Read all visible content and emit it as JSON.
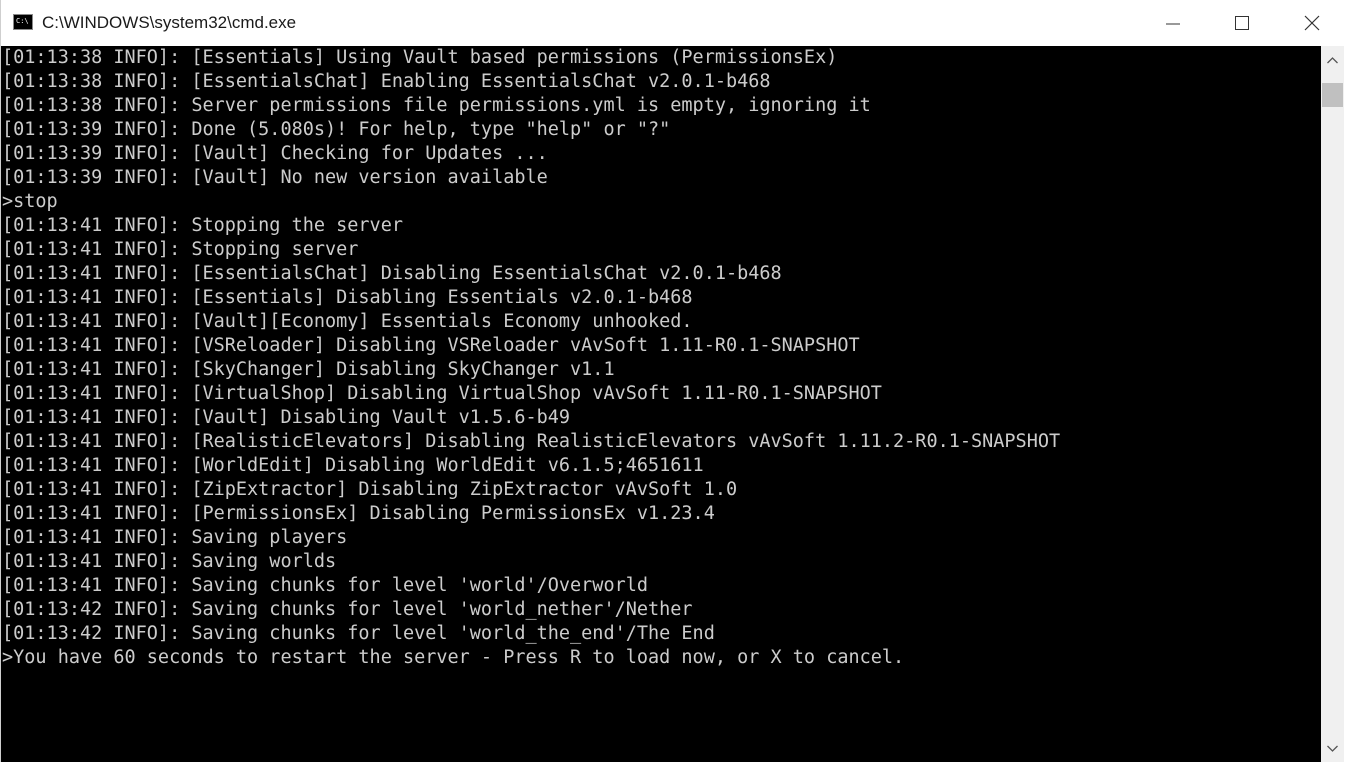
{
  "window": {
    "title": "C:\\WINDOWS\\system32\\cmd.exe",
    "app_icon_text": "C:\\",
    "controls": {
      "minimize": "minimize",
      "maximize": "maximize",
      "close": "close"
    }
  },
  "colors": {
    "console_background": "#000000",
    "console_text": "#cccccc",
    "titlebar": "#ffffff",
    "scrollbar_track": "#f0f0f0",
    "scrollbar_thumb": "#c0c0c0"
  },
  "console": {
    "lines": [
      "[01:13:38 INFO]: [Essentials] Using Vault based permissions (PermissionsEx)",
      "[01:13:38 INFO]: [EssentialsChat] Enabling EssentialsChat v2.0.1-b468",
      "[01:13:38 INFO]: Server permissions file permissions.yml is empty, ignoring it",
      "[01:13:39 INFO]: Done (5.080s)! For help, type \"help\" or \"?\"",
      "[01:13:39 INFO]: [Vault] Checking for Updates ...",
      "[01:13:39 INFO]: [Vault] No new version available",
      ">stop",
      "[01:13:41 INFO]: Stopping the server",
      "[01:13:41 INFO]: Stopping server",
      "[01:13:41 INFO]: [EssentialsChat] Disabling EssentialsChat v2.0.1-b468",
      "[01:13:41 INFO]: [Essentials] Disabling Essentials v2.0.1-b468",
      "[01:13:41 INFO]: [Vault][Economy] Essentials Economy unhooked.",
      "[01:13:41 INFO]: [VSReloader] Disabling VSReloader vAvSoft 1.11-R0.1-SNAPSHOT",
      "[01:13:41 INFO]: [SkyChanger] Disabling SkyChanger v1.1",
      "[01:13:41 INFO]: [VirtualShop] Disabling VirtualShop vAvSoft 1.11-R0.1-SNAPSHOT",
      "[01:13:41 INFO]: [Vault] Disabling Vault v1.5.6-b49",
      "[01:13:41 INFO]: [RealisticElevators] Disabling RealisticElevators vAvSoft 1.11.2-R0.1-SNAPSHOT",
      "[01:13:41 INFO]: [WorldEdit] Disabling WorldEdit v6.1.5;4651611",
      "[01:13:41 INFO]: [ZipExtractor] Disabling ZipExtractor vAvSoft 1.0",
      "[01:13:41 INFO]: [PermissionsEx] Disabling PermissionsEx v1.23.4",
      "[01:13:41 INFO]: Saving players",
      "[01:13:41 INFO]: Saving worlds",
      "[01:13:41 INFO]: Saving chunks for level 'world'/Overworld",
      "[01:13:42 INFO]: Saving chunks for level 'world_nether'/Nether",
      "[01:13:42 INFO]: Saving chunks for level 'world_the_end'/The End",
      ">You have 60 seconds to restart the server - Press R to load now, or X to cancel."
    ]
  },
  "scrollbar": {
    "up_icon": "chevron-up-icon",
    "down_icon": "chevron-down-icon"
  }
}
